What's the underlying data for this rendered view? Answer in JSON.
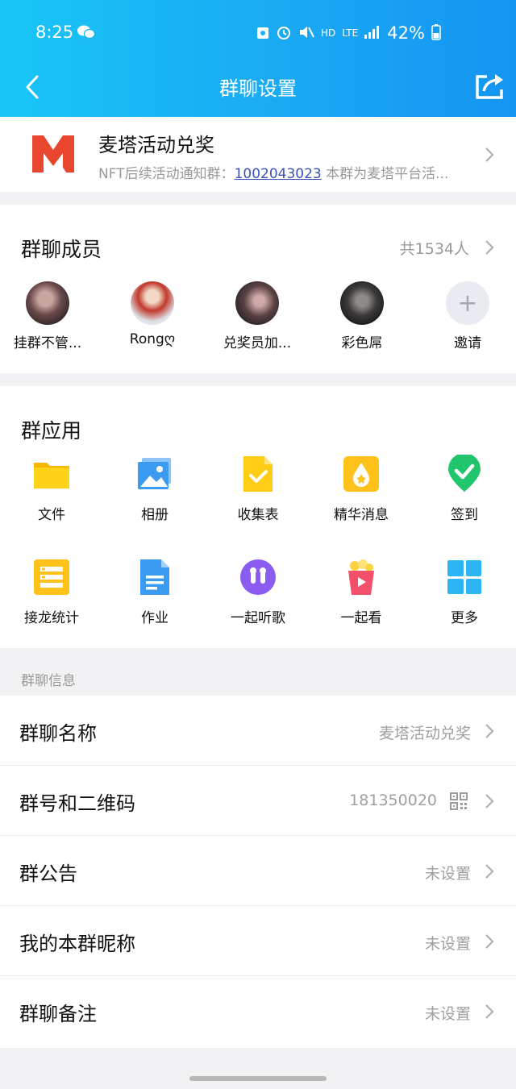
{
  "status_bar": {
    "time": "8:25",
    "network_hd": "HD",
    "network_lte": "LTE",
    "battery": "42%"
  },
  "nav": {
    "title": "群聊设置"
  },
  "group": {
    "name": "麦塔活动兑奖",
    "desc_prefix": "NFT后续活动通知群：",
    "desc_link": "1002043023",
    "desc_suffix": " 本群为麦塔平台活..."
  },
  "members": {
    "title": "群聊成员",
    "count": "共1534人",
    "items": [
      {
        "name": "挂群不管..."
      },
      {
        "name": "Rongღ"
      },
      {
        "name": "兑奖员加..."
      },
      {
        "name": "彩色屌"
      },
      {
        "name": "邀请"
      }
    ]
  },
  "apps": {
    "title": "群应用",
    "items": [
      {
        "label": "文件",
        "icon": "folder-icon"
      },
      {
        "label": "相册",
        "icon": "photo-album-icon"
      },
      {
        "label": "收集表",
        "icon": "form-icon"
      },
      {
        "label": "精华消息",
        "icon": "essence-icon"
      },
      {
        "label": "签到",
        "icon": "checkin-icon"
      },
      {
        "label": "接龙统计",
        "icon": "chain-stats-icon"
      },
      {
        "label": "作业",
        "icon": "homework-icon"
      },
      {
        "label": "一起听歌",
        "icon": "earphones-icon"
      },
      {
        "label": "一起看",
        "icon": "popcorn-icon"
      },
      {
        "label": "更多",
        "icon": "grid-icon"
      }
    ]
  },
  "info": {
    "header": "群聊信息",
    "rows": [
      {
        "label": "群聊名称",
        "value": "麦塔活动兑奖"
      },
      {
        "label": "群号和二维码",
        "value": "181350020"
      },
      {
        "label": "群公告",
        "value": "未设置"
      },
      {
        "label": "我的本群昵称",
        "value": "未设置"
      },
      {
        "label": "群聊备注",
        "value": "未设置"
      }
    ]
  },
  "colors": {
    "header_start": "#19c6f6",
    "header_end": "#1495f2",
    "link": "#3a53b8",
    "muted": "#999999"
  }
}
